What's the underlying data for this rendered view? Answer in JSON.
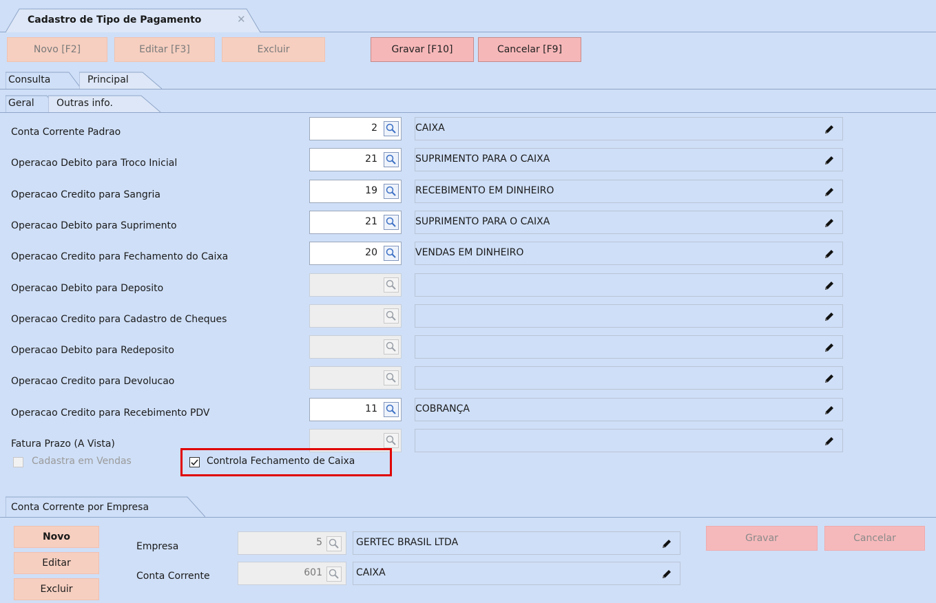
{
  "window": {
    "tab_title": "Cadastro de Tipo de Pagamento",
    "close_glyph": "✕"
  },
  "toolbar": {
    "novo": "Novo [F2]",
    "editar": "Editar [F3]",
    "excluir": "Excluir",
    "gravar": "Gravar [F10]",
    "cancelar": "Cancelar [F9]"
  },
  "tabs_level1": {
    "consulta": "Consulta",
    "principal": "Principal"
  },
  "tabs_level2": {
    "geral": "Geral",
    "outras": "Outras info."
  },
  "rows": [
    {
      "label": "Conta Corrente Padrao",
      "code": "2",
      "desc": "CAIXA",
      "enabled": true
    },
    {
      "label": "Operacao Debito para Troco Inicial",
      "code": "21",
      "desc": "SUPRIMENTO PARA O CAIXA",
      "enabled": true
    },
    {
      "label": "Operacao Credito para Sangria",
      "code": "19",
      "desc": "RECEBIMENTO EM DINHEIRO",
      "enabled": true
    },
    {
      "label": "Operacao Debito para Suprimento",
      "code": "21",
      "desc": "SUPRIMENTO PARA O CAIXA",
      "enabled": true
    },
    {
      "label": "Operacao Credito para Fechamento do Caixa",
      "code": "20",
      "desc": "VENDAS EM DINHEIRO",
      "enabled": true
    },
    {
      "label": "Operacao Debito para Deposito",
      "code": "",
      "desc": "",
      "enabled": false
    },
    {
      "label": "Operacao Credito para Cadastro de Cheques",
      "code": "",
      "desc": "",
      "enabled": false
    },
    {
      "label": "Operacao Debito para Redeposito",
      "code": "",
      "desc": "",
      "enabled": false
    },
    {
      "label": "Operacao Credito para Devolucao",
      "code": "",
      "desc": "",
      "enabled": false
    },
    {
      "label": "Operacao Credito para Recebimento PDV",
      "code": "11",
      "desc": "COBRANÇA",
      "enabled": true
    },
    {
      "label": "Fatura Prazo (A Vista)",
      "code": "",
      "desc": "",
      "enabled": false
    }
  ],
  "checkboxes": {
    "cadastra_vendas": {
      "label": "Cadastra em Vendas",
      "checked": false
    },
    "controla_fechamento": {
      "label": "Controla Fechamento de Caixa",
      "checked": true
    }
  },
  "section2": {
    "tab_title": "Conta Corrente por Empresa",
    "buttons": {
      "novo": "Novo",
      "editar": "Editar",
      "excluir": "Excluir"
    },
    "empresa": {
      "label": "Empresa",
      "code": "5",
      "desc": "GERTEC BRASIL LTDA"
    },
    "conta": {
      "label": "Conta Corrente",
      "code": "601",
      "desc": "CAIXA"
    },
    "gravar": "Gravar",
    "cancelar": "Cancelar"
  },
  "colors": {
    "background": "#cfdff7",
    "disabled_button": "#f6cfc0",
    "active_button": "#f6b7b8",
    "highlight": "#e00000"
  },
  "icons": [
    "lookup-magnifier-icon",
    "edit-pencil-icon",
    "close-icon",
    "checkmark-icon"
  ]
}
